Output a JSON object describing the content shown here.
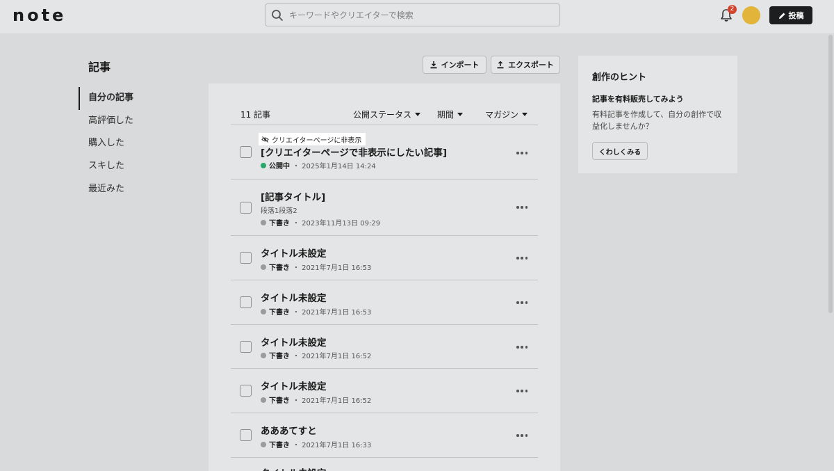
{
  "header": {
    "logo": "note",
    "search_placeholder": "キーワードやクリエイターで検索",
    "notification_count": "2",
    "post_label": "投稿"
  },
  "page": {
    "title": "記事"
  },
  "sidebar": {
    "items": [
      {
        "label": "自分の記事",
        "active": true
      },
      {
        "label": "高評価した"
      },
      {
        "label": "購入した"
      },
      {
        "label": "スキした"
      },
      {
        "label": "最近みた"
      }
    ]
  },
  "toolbar": {
    "import_label": "インポート",
    "export_label": "エクスポート"
  },
  "list": {
    "count": "11 記事",
    "filters": [
      "公開ステータス",
      "期間",
      "マガジン"
    ],
    "hidden_tag": "クリエイターページに非表示",
    "articles": [
      {
        "title": "[クリエイターページで非表示にしたい記事]",
        "status": "公開中",
        "date": "・ 2025年1月14日 14:24",
        "published": true
      },
      {
        "title": "[記事タイトル]",
        "excerpt": "段落1段落2",
        "status": "下書き",
        "date": "・ 2023年11月13日 09:29"
      },
      {
        "title": "タイトル未設定",
        "status": "下書き",
        "date": "・ 2021年7月1日 16:53"
      },
      {
        "title": "タイトル未設定",
        "status": "下書き",
        "date": "・ 2021年7月1日 16:53"
      },
      {
        "title": "タイトル未設定",
        "status": "下書き",
        "date": "・ 2021年7月1日 16:52"
      },
      {
        "title": "タイトル未設定",
        "status": "下書き",
        "date": "・ 2021年7月1日 16:52"
      },
      {
        "title": "あああてすと",
        "status": "下書き",
        "date": "・ 2021年7月1日 16:33"
      },
      {
        "title": "タイトル未設定"
      }
    ]
  },
  "hint": {
    "title": "創作のヒント",
    "subtitle": "記事を有料販売してみよう",
    "body": "有料記事を作成して、自分の創作で収益化しませんか？",
    "button": "くわしくみる"
  }
}
